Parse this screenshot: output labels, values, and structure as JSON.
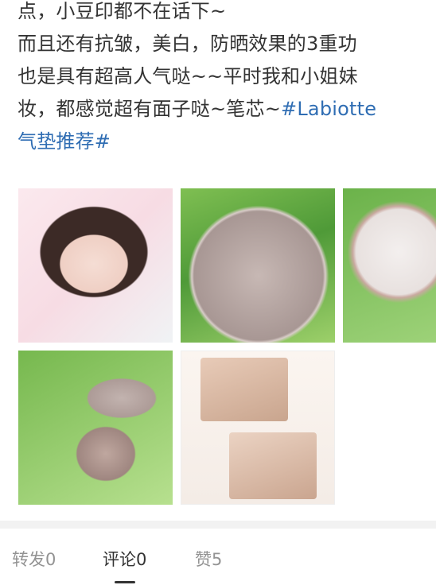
{
  "post": {
    "lines": [
      "点，小豆印都不在话下~",
      "而且还有抗皱，美白，防晒效果的3重功",
      "也是具有超高人气哒~~平时我和小姐妹",
      "妆，都感觉超有面子哒~笔芯~"
    ],
    "hashtag_part1": "#Labiotte",
    "hashtag_part2": "气垫推荐#"
  },
  "images": [
    {
      "name": "selfie-with-cushion"
    },
    {
      "name": "pocket-watch-cushion-closed"
    },
    {
      "name": "cushion-open-puff"
    },
    {
      "name": "cushion-open-two-tone"
    },
    {
      "name": "swatch-collage"
    }
  ],
  "tabs": {
    "repost": "转发0",
    "comment": "评论0",
    "like": "赞5"
  }
}
